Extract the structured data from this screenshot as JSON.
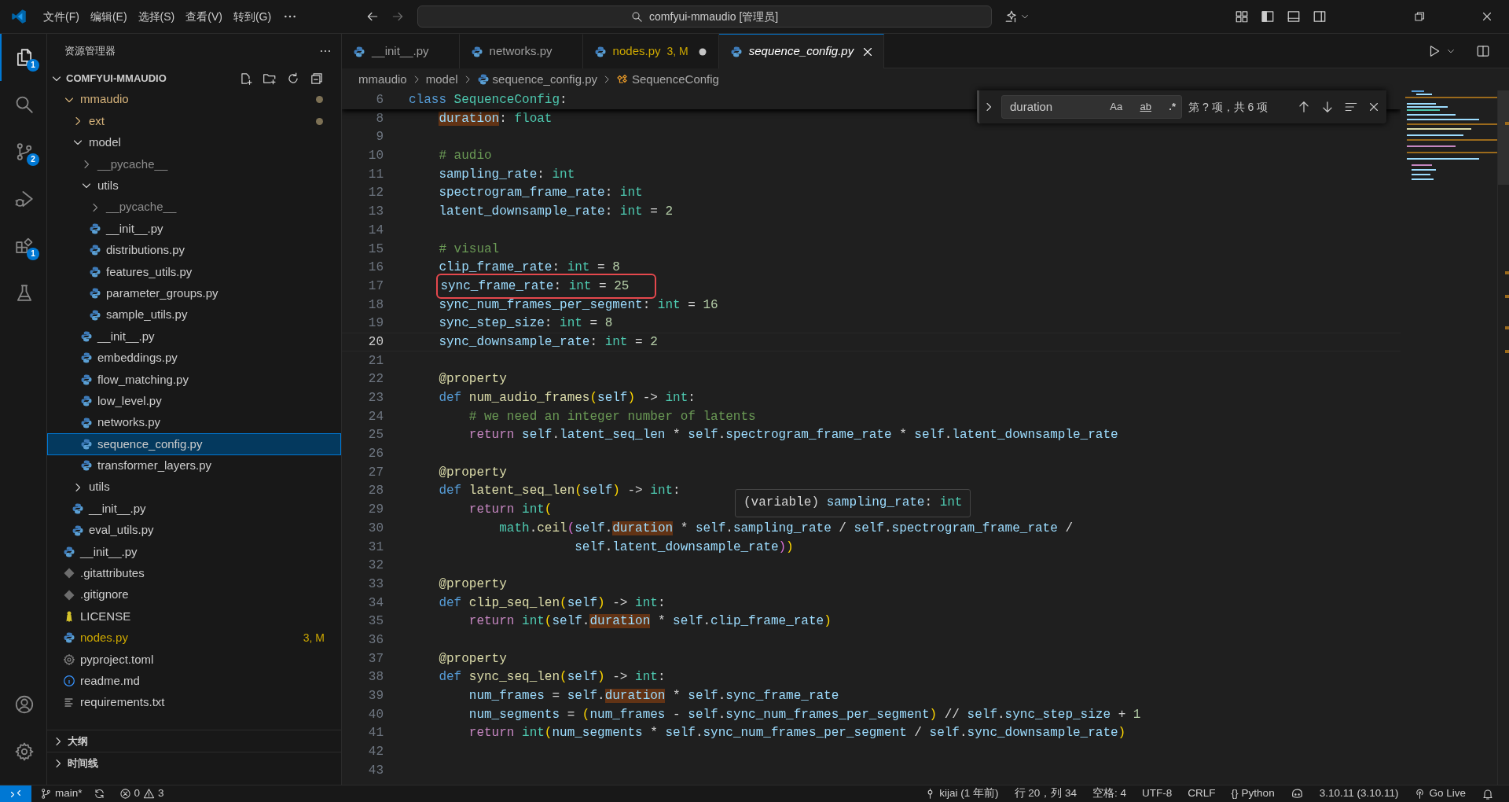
{
  "title_bar": {
    "menus": [
      "文件(F)",
      "编辑(E)",
      "选择(S)",
      "查看(V)",
      "转到(G)"
    ],
    "command_center": "comfyui-mmaudio [管理员]"
  },
  "activity_bar": {
    "items": [
      {
        "kind": "explorer",
        "selected": true,
        "badge": "1"
      },
      {
        "kind": "search",
        "selected": false
      },
      {
        "kind": "scm",
        "selected": false,
        "badge": "2"
      },
      {
        "kind": "debug",
        "selected": false
      },
      {
        "kind": "extensions",
        "selected": false,
        "badge": "1"
      },
      {
        "kind": "testing",
        "selected": false
      }
    ],
    "bottom": [
      {
        "kind": "account"
      },
      {
        "kind": "settings"
      }
    ]
  },
  "sidebar": {
    "title": "资源管理器",
    "section": {
      "label": "COMFYUI-MMAUDIO",
      "expanded": true
    },
    "tree": [
      {
        "label": "mmaudio",
        "kind": "folder",
        "expanded": true,
        "selected": false,
        "modified": true,
        "ignored": false,
        "children": [
          {
            "label": "ext",
            "kind": "folder",
            "expanded": false,
            "selected": false,
            "modified": true,
            "ignored": false
          },
          {
            "label": "model",
            "kind": "folder",
            "expanded": true,
            "selected": false,
            "modified": false,
            "ignored": false,
            "children": [
              {
                "label": "__pycache__",
                "kind": "folder",
                "expanded": false,
                "selected": false,
                "modified": false,
                "ignored": true
              },
              {
                "label": "utils",
                "kind": "folder",
                "expanded": true,
                "selected": false,
                "modified": false,
                "ignored": false,
                "children": [
                  {
                    "label": "__pycache__",
                    "kind": "folder",
                    "expanded": false,
                    "selected": false,
                    "modified": false,
                    "ignored": true
                  },
                  {
                    "label": "__init__.py",
                    "kind": "python",
                    "selected": false,
                    "modified": false,
                    "ignored": false
                  },
                  {
                    "label": "distributions.py",
                    "kind": "python",
                    "selected": false,
                    "modified": false,
                    "ignored": false
                  },
                  {
                    "label": "features_utils.py",
                    "kind": "python",
                    "selected": false,
                    "modified": false,
                    "ignored": false
                  },
                  {
                    "label": "parameter_groups.py",
                    "kind": "python",
                    "selected": false,
                    "modified": false,
                    "ignored": false
                  },
                  {
                    "label": "sample_utils.py",
                    "kind": "python",
                    "selected": false,
                    "modified": false,
                    "ignored": false
                  }
                ]
              },
              {
                "label": "__init__.py",
                "kind": "python",
                "selected": false,
                "modified": false,
                "ignored": false
              },
              {
                "label": "embeddings.py",
                "kind": "python",
                "selected": false,
                "modified": false,
                "ignored": false
              },
              {
                "label": "flow_matching.py",
                "kind": "python",
                "selected": false,
                "modified": false,
                "ignored": false
              },
              {
                "label": "low_level.py",
                "kind": "python",
                "selected": false,
                "modified": false,
                "ignored": false
              },
              {
                "label": "networks.py",
                "kind": "python",
                "selected": false,
                "modified": false,
                "ignored": false
              },
              {
                "label": "sequence_config.py",
                "kind": "python",
                "selected": true,
                "modified": false,
                "ignored": false
              },
              {
                "label": "transformer_layers.py",
                "kind": "python",
                "selected": false,
                "modified": false,
                "ignored": false
              }
            ]
          },
          {
            "label": "utils",
            "kind": "folder",
            "expanded": false,
            "selected": false,
            "modified": false,
            "ignored": false
          },
          {
            "label": "__init__.py",
            "kind": "python",
            "selected": false,
            "modified": false,
            "ignored": false
          },
          {
            "label": "eval_utils.py",
            "kind": "python",
            "selected": false,
            "modified": false,
            "ignored": false
          }
        ]
      },
      {
        "label": "__init__.py",
        "kind": "python",
        "selected": false,
        "modified": false,
        "ignored": false
      },
      {
        "label": ".gitattributes",
        "kind": "git",
        "selected": false,
        "modified": false,
        "ignored": false
      },
      {
        "label": ".gitignore",
        "kind": "git",
        "selected": false,
        "modified": false,
        "ignored": false
      },
      {
        "label": "LICENSE",
        "kind": "license",
        "selected": false,
        "modified": false,
        "ignored": false
      },
      {
        "label": "nodes.py",
        "kind": "python",
        "selected": false,
        "modified": true,
        "ignored": false,
        "badge": "3, M"
      },
      {
        "label": "pyproject.toml",
        "kind": "config",
        "selected": false,
        "modified": false,
        "ignored": false
      },
      {
        "label": "readme.md",
        "kind": "info",
        "selected": false,
        "modified": false,
        "ignored": false
      },
      {
        "label": "requirements.txt",
        "kind": "text",
        "selected": false,
        "modified": false,
        "ignored": false
      }
    ],
    "panels": [
      {
        "label": "大纲",
        "expanded": false
      },
      {
        "label": "时间线",
        "expanded": false
      }
    ]
  },
  "tabs": [
    {
      "label": "__init__.py",
      "selected": false,
      "modified": false,
      "dirty": false,
      "preview": false
    },
    {
      "label": "networks.py",
      "selected": false,
      "modified": false,
      "dirty": false,
      "preview": false
    },
    {
      "label": "nodes.py",
      "selected": false,
      "modified": true,
      "badge": "3, M",
      "dirty": true,
      "preview": false
    },
    {
      "label": "sequence_config.py",
      "selected": true,
      "modified": false,
      "dirty": false,
      "preview": true
    }
  ],
  "breadcrumb": [
    {
      "label": "mmaudio",
      "kind": "folder"
    },
    {
      "label": "model",
      "kind": "folder"
    },
    {
      "label": "sequence_config.py",
      "kind": "python"
    },
    {
      "label": "SequenceConfig",
      "kind": "class"
    }
  ],
  "find": {
    "value": "duration",
    "options": [
      {
        "label": "Aa",
        "kind": "case",
        "selected": false
      },
      {
        "label": "ab",
        "kind": "word",
        "selected": false
      },
      {
        "label": ".*",
        "kind": "regex",
        "selected": false
      }
    ],
    "result": "第 ? 项，共 6 项"
  },
  "editor": {
    "sticky": {
      "number": "6",
      "tokens": [
        {
          "text": "class ",
          "kind": "keyword"
        },
        {
          "text": "SequenceConfig",
          "kind": "type"
        },
        {
          "text": ":",
          "kind": "plain"
        }
      ]
    },
    "lines": [
      {
        "number": "8",
        "current": false,
        "boxed": false,
        "tokens": [
          {
            "text": "    duration",
            "kind": "match"
          },
          {
            "text": ": ",
            "kind": "plain"
          },
          {
            "text": "float",
            "kind": "type"
          }
        ]
      },
      {
        "number": "9",
        "current": false,
        "boxed": false
      },
      {
        "number": "10",
        "current": false,
        "boxed": false,
        "tokens": [
          {
            "text": "    # audio",
            "kind": "comment"
          }
        ]
      },
      {
        "number": "11",
        "current": false,
        "boxed": false,
        "tokens": [
          {
            "text": "    sampling_rate",
            "kind": "variable"
          },
          {
            "text": ": ",
            "kind": "plain"
          },
          {
            "text": "int",
            "kind": "type"
          }
        ]
      },
      {
        "number": "12",
        "current": false,
        "boxed": false,
        "tokens": [
          {
            "text": "    spectrogram_frame_rate",
            "kind": "variable"
          },
          {
            "text": ": ",
            "kind": "plain"
          },
          {
            "text": "int",
            "kind": "type"
          }
        ]
      },
      {
        "number": "13",
        "current": false,
        "boxed": false,
        "tokens": [
          {
            "text": "    latent_downsample_rate",
            "kind": "variable"
          },
          {
            "text": ": ",
            "kind": "plain"
          },
          {
            "text": "int",
            "kind": "type"
          },
          {
            "text": " = ",
            "kind": "plain"
          },
          {
            "text": "2",
            "kind": "number"
          }
        ]
      },
      {
        "number": "14",
        "current": false,
        "boxed": false
      },
      {
        "number": "15",
        "current": false,
        "boxed": false,
        "tokens": [
          {
            "text": "    # visual",
            "kind": "comment"
          }
        ]
      },
      {
        "number": "16",
        "current": false,
        "boxed": false,
        "tokens": [
          {
            "text": "    clip_frame_rate",
            "kind": "variable"
          },
          {
            "text": ": ",
            "kind": "plain"
          },
          {
            "text": "int",
            "kind": "type"
          },
          {
            "text": " = ",
            "kind": "plain"
          },
          {
            "text": "8",
            "kind": "number"
          }
        ]
      },
      {
        "number": "17",
        "current": false,
        "boxed": true,
        "tokens": [
          {
            "text": "    sync_frame_rate",
            "kind": "variable"
          },
          {
            "text": ": ",
            "kind": "plain"
          },
          {
            "text": "int",
            "kind": "type"
          },
          {
            "text": " = ",
            "kind": "plain"
          },
          {
            "text": "25",
            "kind": "number"
          }
        ]
      },
      {
        "number": "18",
        "current": false,
        "boxed": false,
        "tokens": [
          {
            "text": "    sync_num_frames_per_segment",
            "kind": "variable"
          },
          {
            "text": ": ",
            "kind": "plain"
          },
          {
            "text": "int",
            "kind": "type"
          },
          {
            "text": " = ",
            "kind": "plain"
          },
          {
            "text": "16",
            "kind": "number"
          }
        ]
      },
      {
        "number": "19",
        "current": false,
        "boxed": false,
        "tokens": [
          {
            "text": "    sync_step_size",
            "kind": "variable"
          },
          {
            "text": ": ",
            "kind": "plain"
          },
          {
            "text": "int",
            "kind": "type"
          },
          {
            "text": " = ",
            "kind": "plain"
          },
          {
            "text": "8",
            "kind": "number"
          }
        ]
      },
      {
        "number": "20",
        "current": true,
        "boxed": false,
        "tokens": [
          {
            "text": "    sync_downsample_rate",
            "kind": "variable"
          },
          {
            "text": ": ",
            "kind": "plain"
          },
          {
            "text": "int",
            "kind": "type"
          },
          {
            "text": " = ",
            "kind": "plain"
          },
          {
            "text": "2",
            "kind": "number"
          }
        ]
      },
      {
        "number": "21",
        "current": false,
        "boxed": false
      },
      {
        "number": "22",
        "current": false,
        "boxed": false,
        "tokens": [
          {
            "text": "    @property",
            "kind": "decorator"
          }
        ]
      },
      {
        "number": "23",
        "current": false,
        "boxed": false,
        "tokens": [
          {
            "text": "    def ",
            "kind": "keyword"
          },
          {
            "text": "num_audio_frames",
            "kind": "function"
          },
          {
            "text": "(",
            "kind": "bracket1"
          },
          {
            "text": "self",
            "kind": "variable"
          },
          {
            "text": ")",
            "kind": "bracket1"
          },
          {
            "text": " -> ",
            "kind": "plain"
          },
          {
            "text": "int",
            "kind": "type"
          },
          {
            "text": ":",
            "kind": "plain"
          }
        ]
      },
      {
        "number": "24",
        "current": false,
        "boxed": false,
        "tokens": [
          {
            "text": "        # we need an integer number of latents",
            "kind": "comment"
          }
        ]
      },
      {
        "number": "25",
        "current": false,
        "boxed": false,
        "tokens": [
          {
            "text": "        return ",
            "kind": "control"
          },
          {
            "text": "self",
            "kind": "variable"
          },
          {
            "text": ".",
            "kind": "plain"
          },
          {
            "text": "latent_seq_len",
            "kind": "variable"
          },
          {
            "text": " * ",
            "kind": "plain"
          },
          {
            "text": "self",
            "kind": "variable"
          },
          {
            "text": ".",
            "kind": "plain"
          },
          {
            "text": "spectrogram_frame_rate",
            "kind": "variable"
          },
          {
            "text": " * ",
            "kind": "plain"
          },
          {
            "text": "self",
            "kind": "variable"
          },
          {
            "text": ".",
            "kind": "plain"
          },
          {
            "text": "latent_downsample_rate",
            "kind": "variable"
          }
        ]
      },
      {
        "number": "26",
        "current": false,
        "boxed": false
      },
      {
        "number": "27",
        "current": false,
        "boxed": false,
        "tokens": [
          {
            "text": "    @property",
            "kind": "decorator"
          }
        ]
      },
      {
        "number": "28",
        "current": false,
        "boxed": false,
        "tokens": [
          {
            "text": "    def ",
            "kind": "keyword"
          },
          {
            "text": "latent_seq_len",
            "kind": "function"
          },
          {
            "text": "(",
            "kind": "bracket1"
          },
          {
            "text": "self",
            "kind": "variable"
          },
          {
            "text": ")",
            "kind": "bracket1"
          },
          {
            "text": " -> ",
            "kind": "plain"
          },
          {
            "text": "int",
            "kind": "type"
          },
          {
            "text": ":",
            "kind": "plain"
          }
        ]
      },
      {
        "number": "29",
        "current": false,
        "boxed": false,
        "tokens": [
          {
            "text": "        return ",
            "kind": "control"
          },
          {
            "text": "int",
            "kind": "type"
          },
          {
            "text": "(",
            "kind": "bracket1"
          }
        ]
      },
      {
        "number": "30",
        "current": false,
        "boxed": false,
        "tokens": [
          {
            "text": "            math",
            "kind": "type"
          },
          {
            "text": ".",
            "kind": "plain"
          },
          {
            "text": "ceil",
            "kind": "function"
          },
          {
            "text": "(",
            "kind": "bracket2"
          },
          {
            "text": "self",
            "kind": "variable"
          },
          {
            "text": ".",
            "kind": "plain"
          },
          {
            "text": "duration",
            "kind": "match"
          },
          {
            "text": " * ",
            "kind": "plain"
          },
          {
            "text": "self",
            "kind": "variable"
          },
          {
            "text": ".",
            "kind": "plain"
          },
          {
            "text": "sampling_rate",
            "kind": "variable"
          },
          {
            "text": " / ",
            "kind": "plain"
          },
          {
            "text": "self",
            "kind": "variable"
          },
          {
            "text": ".",
            "kind": "plain"
          },
          {
            "text": "spectrogram_frame_rate",
            "kind": "variable"
          },
          {
            "text": " /",
            "kind": "plain"
          }
        ]
      },
      {
        "number": "31",
        "current": false,
        "boxed": false,
        "tokens": [
          {
            "text": "                      self",
            "kind": "variable"
          },
          {
            "text": ".",
            "kind": "plain"
          },
          {
            "text": "latent_downsample_rate",
            "kind": "variable"
          },
          {
            "text": ")",
            "kind": "bracket2"
          },
          {
            "text": ")",
            "kind": "bracket1"
          }
        ]
      },
      {
        "number": "32",
        "current": false,
        "boxed": false
      },
      {
        "number": "33",
        "current": false,
        "boxed": false,
        "tokens": [
          {
            "text": "    @property",
            "kind": "decorator"
          }
        ]
      },
      {
        "number": "34",
        "current": false,
        "boxed": false,
        "tokens": [
          {
            "text": "    def ",
            "kind": "keyword"
          },
          {
            "text": "clip_seq_len",
            "kind": "function"
          },
          {
            "text": "(",
            "kind": "bracket1"
          },
          {
            "text": "self",
            "kind": "variable"
          },
          {
            "text": ")",
            "kind": "bracket1"
          },
          {
            "text": " -> ",
            "kind": "plain"
          },
          {
            "text": "int",
            "kind": "type"
          },
          {
            "text": ":",
            "kind": "plain"
          }
        ]
      },
      {
        "number": "35",
        "current": false,
        "boxed": false,
        "tokens": [
          {
            "text": "        return ",
            "kind": "control"
          },
          {
            "text": "int",
            "kind": "type"
          },
          {
            "text": "(",
            "kind": "bracket1"
          },
          {
            "text": "self",
            "kind": "variable"
          },
          {
            "text": ".",
            "kind": "plain"
          },
          {
            "text": "duration",
            "kind": "match"
          },
          {
            "text": " * ",
            "kind": "plain"
          },
          {
            "text": "self",
            "kind": "variable"
          },
          {
            "text": ".",
            "kind": "plain"
          },
          {
            "text": "clip_frame_rate",
            "kind": "variable"
          },
          {
            "text": ")",
            "kind": "bracket1"
          }
        ]
      },
      {
        "number": "36",
        "current": false,
        "boxed": false
      },
      {
        "number": "37",
        "current": false,
        "boxed": false,
        "tokens": [
          {
            "text": "    @property",
            "kind": "decorator"
          }
        ]
      },
      {
        "number": "38",
        "current": false,
        "boxed": false,
        "tokens": [
          {
            "text": "    def ",
            "kind": "keyword"
          },
          {
            "text": "sync_seq_len",
            "kind": "function"
          },
          {
            "text": "(",
            "kind": "bracket1"
          },
          {
            "text": "self",
            "kind": "variable"
          },
          {
            "text": ")",
            "kind": "bracket1"
          },
          {
            "text": " -> ",
            "kind": "plain"
          },
          {
            "text": "int",
            "kind": "type"
          },
          {
            "text": ":",
            "kind": "plain"
          }
        ]
      },
      {
        "number": "39",
        "current": false,
        "boxed": false,
        "tokens": [
          {
            "text": "        num_frames",
            "kind": "variable"
          },
          {
            "text": " = ",
            "kind": "plain"
          },
          {
            "text": "self",
            "kind": "variable"
          },
          {
            "text": ".",
            "kind": "plain"
          },
          {
            "text": "duration",
            "kind": "match"
          },
          {
            "text": " * ",
            "kind": "plain"
          },
          {
            "text": "self",
            "kind": "variable"
          },
          {
            "text": ".",
            "kind": "plain"
          },
          {
            "text": "sync_frame_rate",
            "kind": "variable"
          }
        ]
      },
      {
        "number": "40",
        "current": false,
        "boxed": false,
        "tokens": [
          {
            "text": "        num_segments",
            "kind": "variable"
          },
          {
            "text": " = ",
            "kind": "plain"
          },
          {
            "text": "(",
            "kind": "bracket1"
          },
          {
            "text": "num_frames",
            "kind": "variable"
          },
          {
            "text": " - ",
            "kind": "plain"
          },
          {
            "text": "self",
            "kind": "variable"
          },
          {
            "text": ".",
            "kind": "plain"
          },
          {
            "text": "sync_num_frames_per_segment",
            "kind": "variable"
          },
          {
            "text": ")",
            "kind": "bracket1"
          },
          {
            "text": " // ",
            "kind": "plain"
          },
          {
            "text": "self",
            "kind": "variable"
          },
          {
            "text": ".",
            "kind": "plain"
          },
          {
            "text": "sync_step_size",
            "kind": "variable"
          },
          {
            "text": " + ",
            "kind": "plain"
          },
          {
            "text": "1",
            "kind": "number"
          }
        ]
      },
      {
        "number": "41",
        "current": false,
        "boxed": false,
        "tokens": [
          {
            "text": "        return ",
            "kind": "control"
          },
          {
            "text": "int",
            "kind": "type"
          },
          {
            "text": "(",
            "kind": "bracket1"
          },
          {
            "text": "num_segments",
            "kind": "variable"
          },
          {
            "text": " * ",
            "kind": "plain"
          },
          {
            "text": "self",
            "kind": "variable"
          },
          {
            "text": ".",
            "kind": "plain"
          },
          {
            "text": "sync_num_frames_per_segment",
            "kind": "variable"
          },
          {
            "text": " / ",
            "kind": "plain"
          },
          {
            "text": "self",
            "kind": "variable"
          },
          {
            "text": ".",
            "kind": "plain"
          },
          {
            "text": "sync_downsample_rate",
            "kind": "variable"
          },
          {
            "text": ")",
            "kind": "bracket1"
          }
        ]
      },
      {
        "number": "42",
        "current": false,
        "boxed": false
      },
      {
        "number": "43",
        "current": false,
        "boxed": false
      }
    ],
    "hover": [
      {
        "text": "(variable) ",
        "kind": "plain"
      },
      {
        "text": "sampling_rate",
        "kind": "variable"
      },
      {
        "text": ": ",
        "kind": "plain"
      },
      {
        "text": "int",
        "kind": "type"
      }
    ]
  },
  "status_bar": {
    "branch": "main*",
    "errors": "0",
    "warnings": "3",
    "right": [
      {
        "kind": "blame",
        "text": "kijai (1 年前)"
      },
      {
        "kind": "text",
        "text": "行 20，列 34"
      },
      {
        "kind": "text",
        "text": "空格: 4"
      },
      {
        "kind": "text",
        "text": "UTF-8"
      },
      {
        "kind": "text",
        "text": "CRLF"
      },
      {
        "kind": "language",
        "glyph": "{}",
        "text": "Python"
      },
      {
        "kind": "copilot"
      },
      {
        "kind": "text",
        "text": "3.10.11 (3.10.11)"
      },
      {
        "kind": "live",
        "text": "Go Live"
      },
      {
        "kind": "bell"
      }
    ]
  }
}
